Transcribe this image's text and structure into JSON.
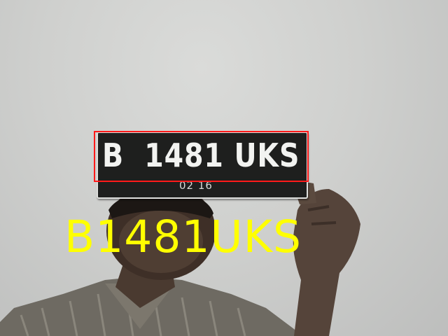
{
  "plate": {
    "main_text": "B  1481 UKS",
    "expiry_text": "02 16"
  },
  "detection": {
    "box_color": "#ff1a1a",
    "recognized_text": "B1481UKS",
    "text_color": "#ffff00"
  }
}
